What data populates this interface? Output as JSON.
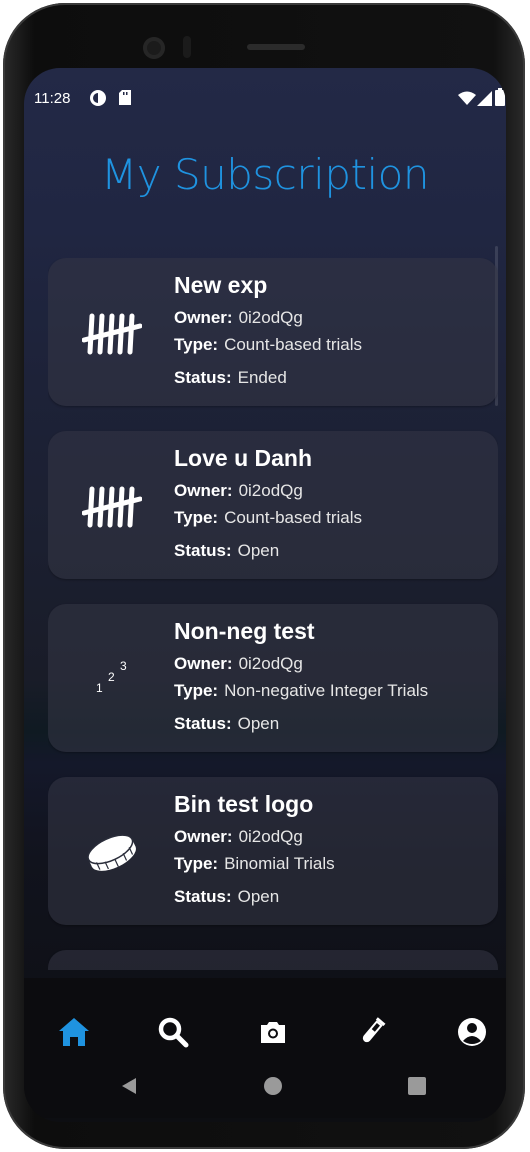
{
  "status_bar": {
    "time": "11:28"
  },
  "page": {
    "title": "My Subscription"
  },
  "labels": {
    "owner": "Owner:",
    "type": "Type:",
    "status": "Status:"
  },
  "subscriptions": [
    {
      "name": "New exp",
      "owner": "0i2odQg",
      "type": "Count-based trials",
      "status": "Ended",
      "icon": "tally-marks-icon"
    },
    {
      "name": "Love u Danh",
      "owner": "0i2odQg",
      "type": "Count-based trials",
      "status": "Open",
      "icon": "tally-marks-icon"
    },
    {
      "name": "Non-neg test",
      "owner": "0i2odQg",
      "type": "Non-negative Integer Trials",
      "status": "Open",
      "icon": "numbers-123-icon"
    },
    {
      "name": "Bin test logo",
      "owner": "0i2odQg",
      "type": "Binomial Trials",
      "status": "Open",
      "icon": "coin-icon"
    }
  ],
  "nav": {
    "items": [
      "home-icon",
      "search-icon",
      "camera-icon",
      "test-tube-icon",
      "profile-icon"
    ],
    "active": "home",
    "active_color": "#1f93e0"
  },
  "numbers_icon": {
    "n1": "1",
    "n2": "2",
    "n3": "3"
  }
}
